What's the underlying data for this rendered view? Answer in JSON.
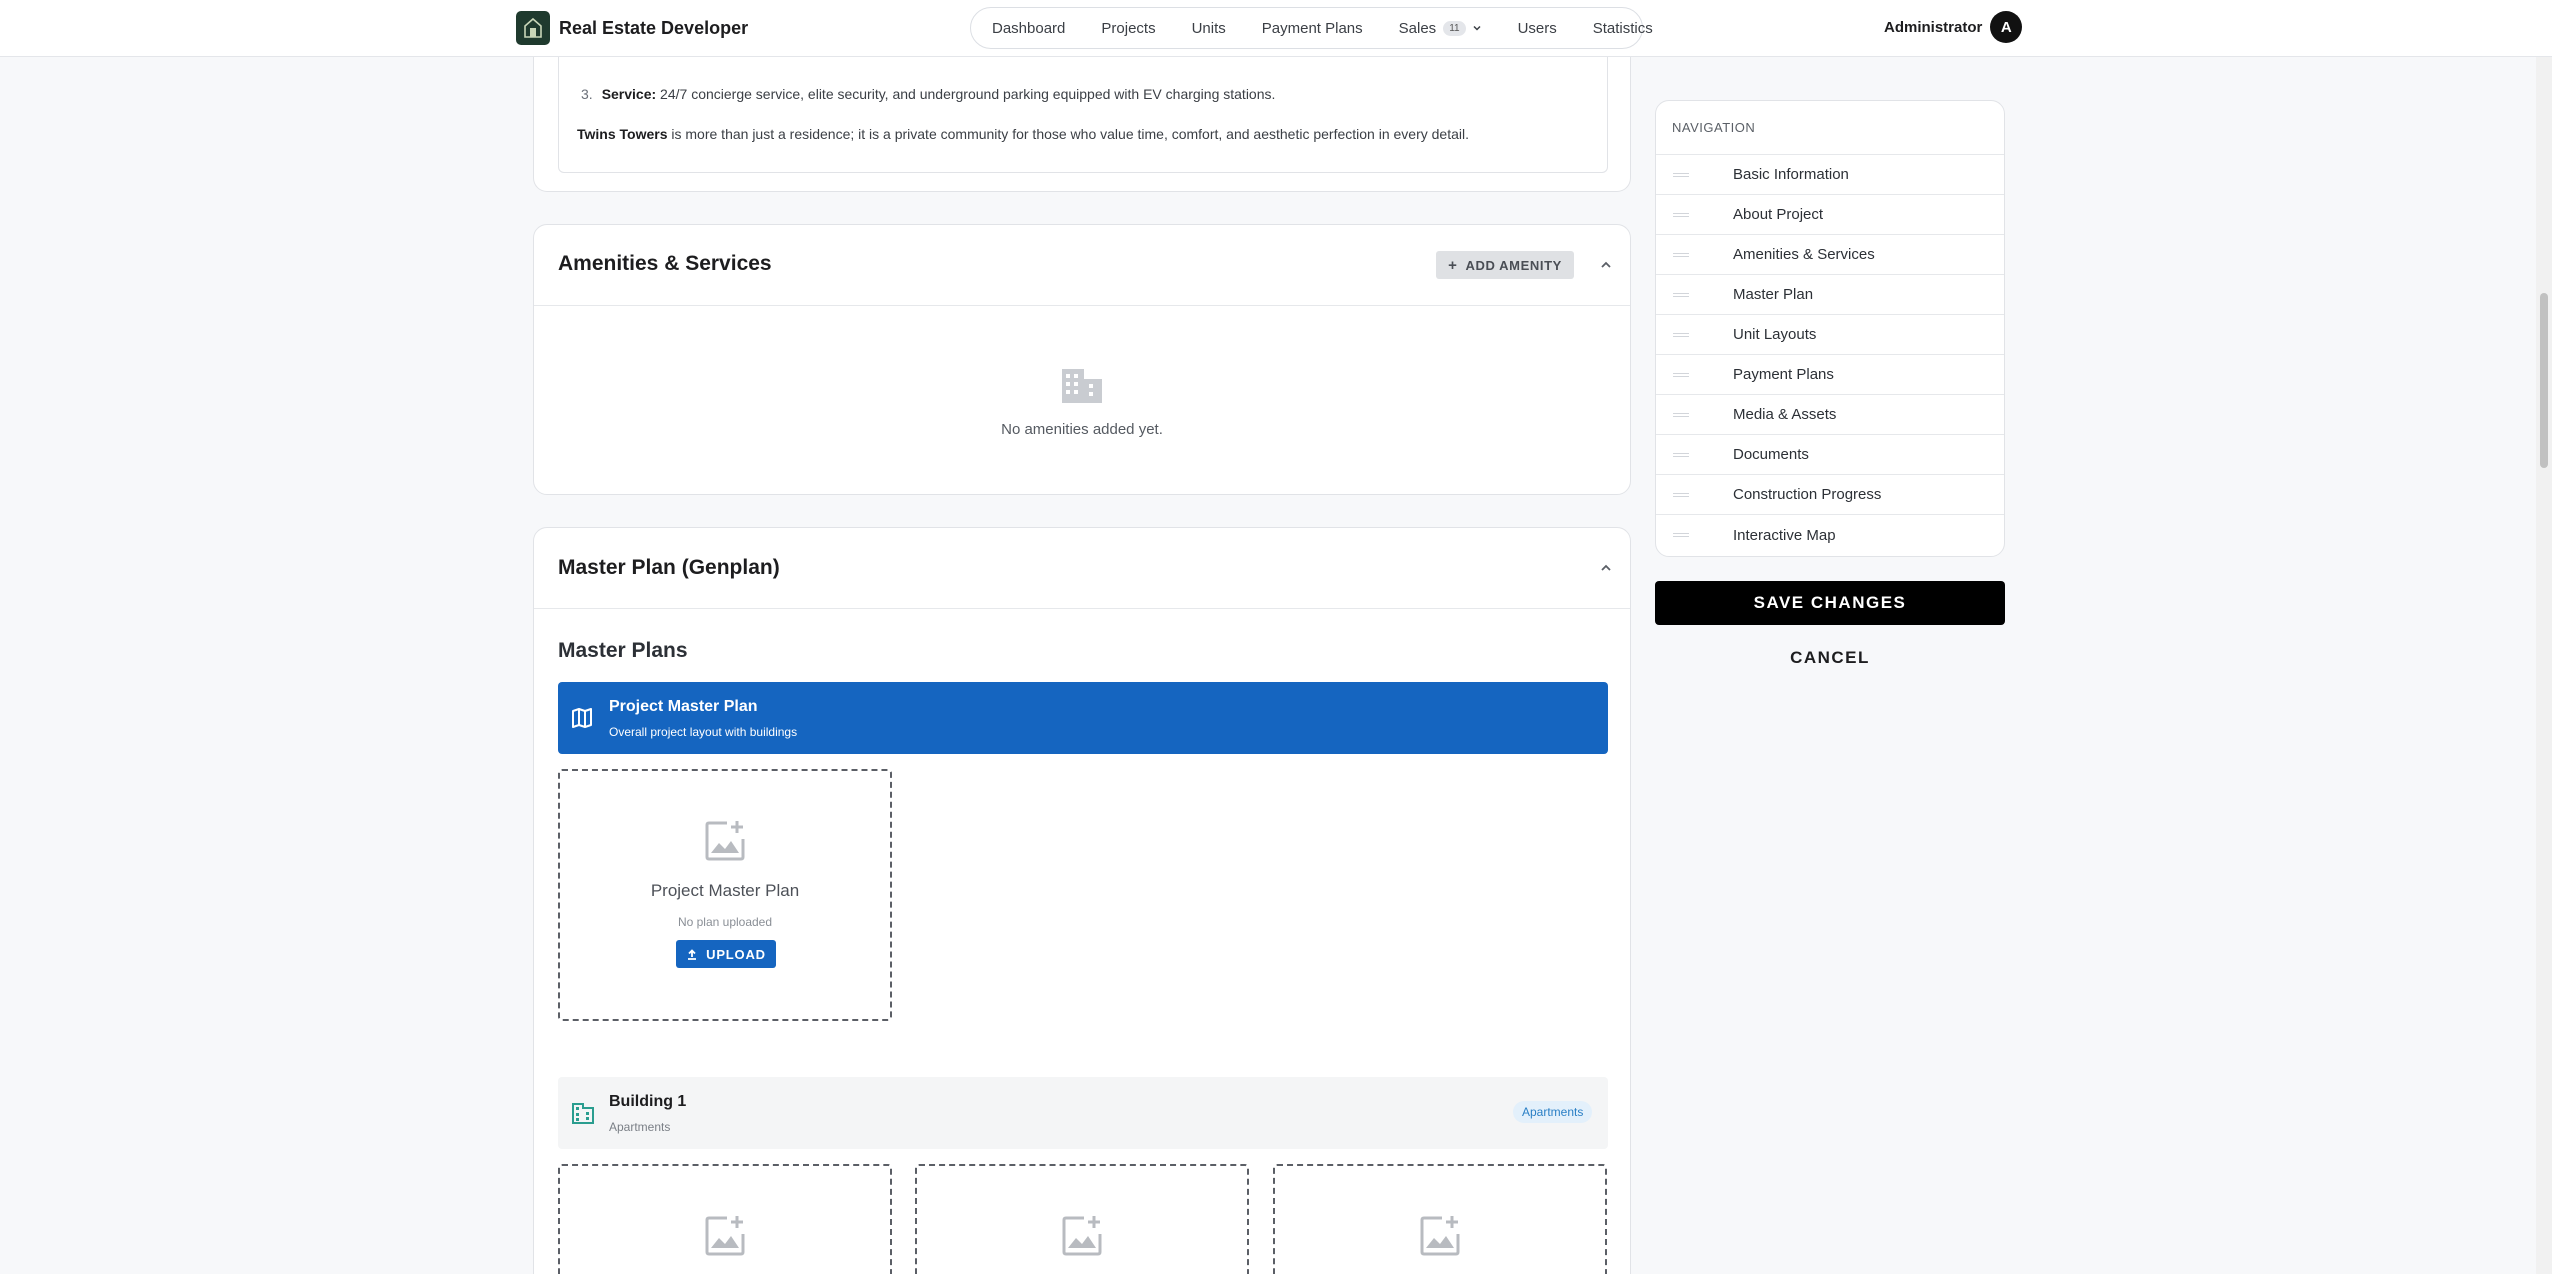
{
  "brand": {
    "name": "Real Estate Developer"
  },
  "nav": {
    "links": [
      "Dashboard",
      "Projects",
      "Units",
      "Payment Plans"
    ],
    "sales_label": "Sales",
    "sales_badge": "11",
    "users_label": "Users",
    "statistics_label": "Statistics"
  },
  "user": {
    "name": "Administrator",
    "initial": "A"
  },
  "about": {
    "item_number": "3.",
    "item_label": "Service:",
    "item_text": " 24/7 concierge service, elite security, and underground parking equipped with EV charging stations.",
    "footer_bold": "Twins Towers",
    "footer_text": " is more than just a residence; it is a private community for those who value time, comfort, and aesthetic perfection in every detail."
  },
  "amenities": {
    "title": "Amenities & Services",
    "add_label": "ADD AMENITY",
    "empty_text": "No amenities added yet."
  },
  "master": {
    "title": "Master Plan (Genplan)",
    "subtitle": "Master Plans",
    "plan_title": "Project Master Plan",
    "plan_desc": "Overall project layout with buildings",
    "upload_title": "Project Master Plan",
    "upload_status": "No plan uploaded",
    "upload_label": "UPLOAD",
    "building_title": "Building 1",
    "building_type": "Apartments",
    "building_chip": "Apartments"
  },
  "sidenav": {
    "heading": "NAVIGATION",
    "items": [
      "Basic Information",
      "About Project",
      "Amenities & Services",
      "Master Plan",
      "Unit Layouts",
      "Payment Plans",
      "Media & Assets",
      "Documents",
      "Construction Progress",
      "Interactive Map"
    ]
  },
  "actions": {
    "save": "SAVE CHANGES",
    "cancel": "CANCEL"
  },
  "colors": {
    "primary": "#1565c0",
    "chip_bg": "#e3f0fb",
    "chip_text": "#2a7fc5",
    "save_bg": "#000000"
  },
  "icons": {
    "brand": "building-logo-icon",
    "collapse": "chevron-up-icon",
    "add": "plus-icon",
    "empty": "building-icon",
    "plan": "map-icon",
    "image_add": "add-photo-icon",
    "upload": "upload-icon",
    "drag": "drag-handle-icon"
  }
}
